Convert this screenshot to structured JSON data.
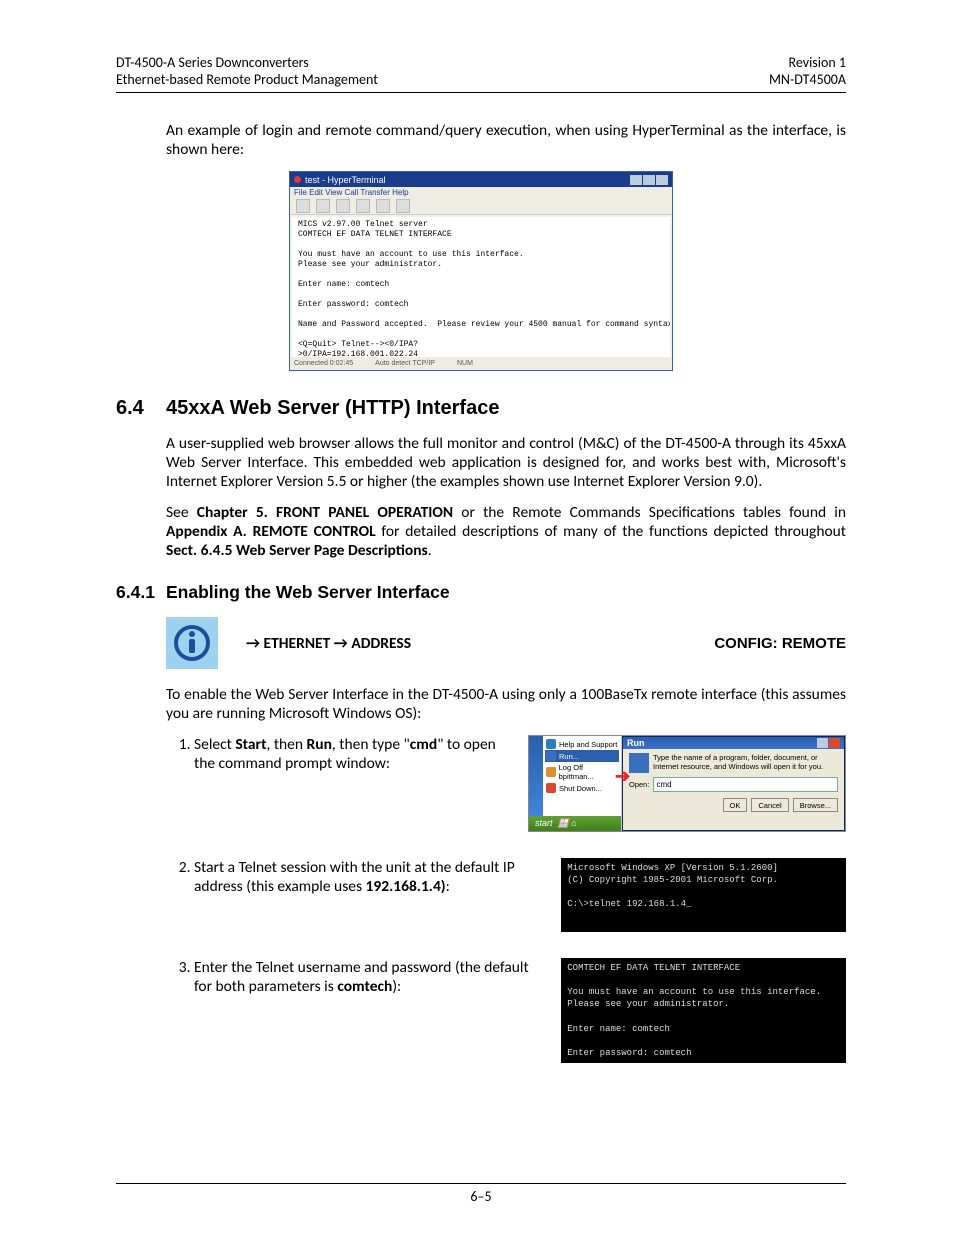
{
  "header": {
    "left1": "DT-4500-A Series Downconverters",
    "left2": "Ethernet-based Remote Product Management",
    "right1": "Revision 1",
    "right2": "MN-DT4500A"
  },
  "intro": "An example of login and remote command/query execution, when using HyperTerminal as the interface, is shown here:",
  "hyper": {
    "title": "test - HyperTerminal",
    "menu": "File  Edit  View  Call  Transfer  Help",
    "body": "MICS v2.97.00 Telnet server\nCOMTECH EF DATA TELNET INTERFACE\n\nYou must have an account to use this interface.\nPlease see your administrator.\n\nEnter name: comtech\n\nEnter password: comtech\n\nName and Password accepted.  Please review your 4500 manual for command syntax.\n\n<Q=Quit> Telnet--><0/IPA?\n>0/IPA=192.168.001.022.24\n\n<Q=Quit> Telnet-->",
    "status1": "Connected 0:02:45",
    "status2": "Auto detect    TCP/IP",
    "status3": "NUM"
  },
  "sec64": {
    "num": "6.4",
    "title": "45xxA Web Server (HTTP) Interface",
    "p1": "A user-supplied web browser allows the full monitor and control (M&C) of the DT-4500-A through its 45xxA Web Server Interface. This embedded web application is designed for, and works best with, Microsoft's Internet Explorer Version 5.5 or higher (the examples shown use Internet Explorer Version 9.0).",
    "p2a": "See ",
    "p2b": "Chapter 5. FRONT PANEL OPERATION",
    "p2c": " or the Remote Commands Specifications tables found in ",
    "p2d": "Appendix A. REMOTE CONTROL",
    "p2e": " for detailed descriptions of many of the functions depicted throughout ",
    "p2f": "Sect. 6.4.5 Web Server Page Descriptions",
    "p2g": "."
  },
  "sec641": {
    "num": "6.4.1",
    "title": "Enabling the Web Server Interface",
    "path": "→ ETHERNET → ADDRESS",
    "config": "CONFIG: REMOTE",
    "intro": "To enable the Web Server Interface in the DT-4500-A using only a 100BaseTx remote interface (this assumes you are running Microsoft Windows OS):"
  },
  "steps": {
    "s1a": "Select ",
    "s1b": "Start",
    "s1c": ", then ",
    "s1d": "Run",
    "s1e": ", then type \"",
    "s1f": "cmd",
    "s1g": "\" to open the command prompt window:",
    "s2a": "Start a Telnet session with the unit at the default IP address (this example uses ",
    "s2b": "192.168.1.4)",
    "s2c": ":",
    "s3a": "Enter the Telnet username and password (the default for both parameters is ",
    "s3b": "comtech",
    "s3c": "):"
  },
  "run": {
    "title": "Run",
    "desc": "Type the name of a program, folder, document, or Internet resource, and Windows will open it for you.",
    "openlbl": "Open:",
    "openval": "cmd",
    "ok": "OK",
    "cancel": "Cancel",
    "browse": "Browse...",
    "menu_help": "Help and Support",
    "menu_run": "Run...",
    "menu_logoff": "Log Off bpittman...",
    "menu_shut": "Shut Down...",
    "start": "start"
  },
  "cmd1": "Microsoft Windows XP [Version 5.1.2600]\n(C) Copyright 1985-2001 Microsoft Corp.\n\nC:\\>telnet 192.168.1.4_",
  "cmd2": "COMTECH EF DATA TELNET INTERFACE\n\nYou must have an account to use this interface.\nPlease see your administrator.\n\nEnter name: comtech\n\nEnter password: comtech",
  "footer": "6–5"
}
